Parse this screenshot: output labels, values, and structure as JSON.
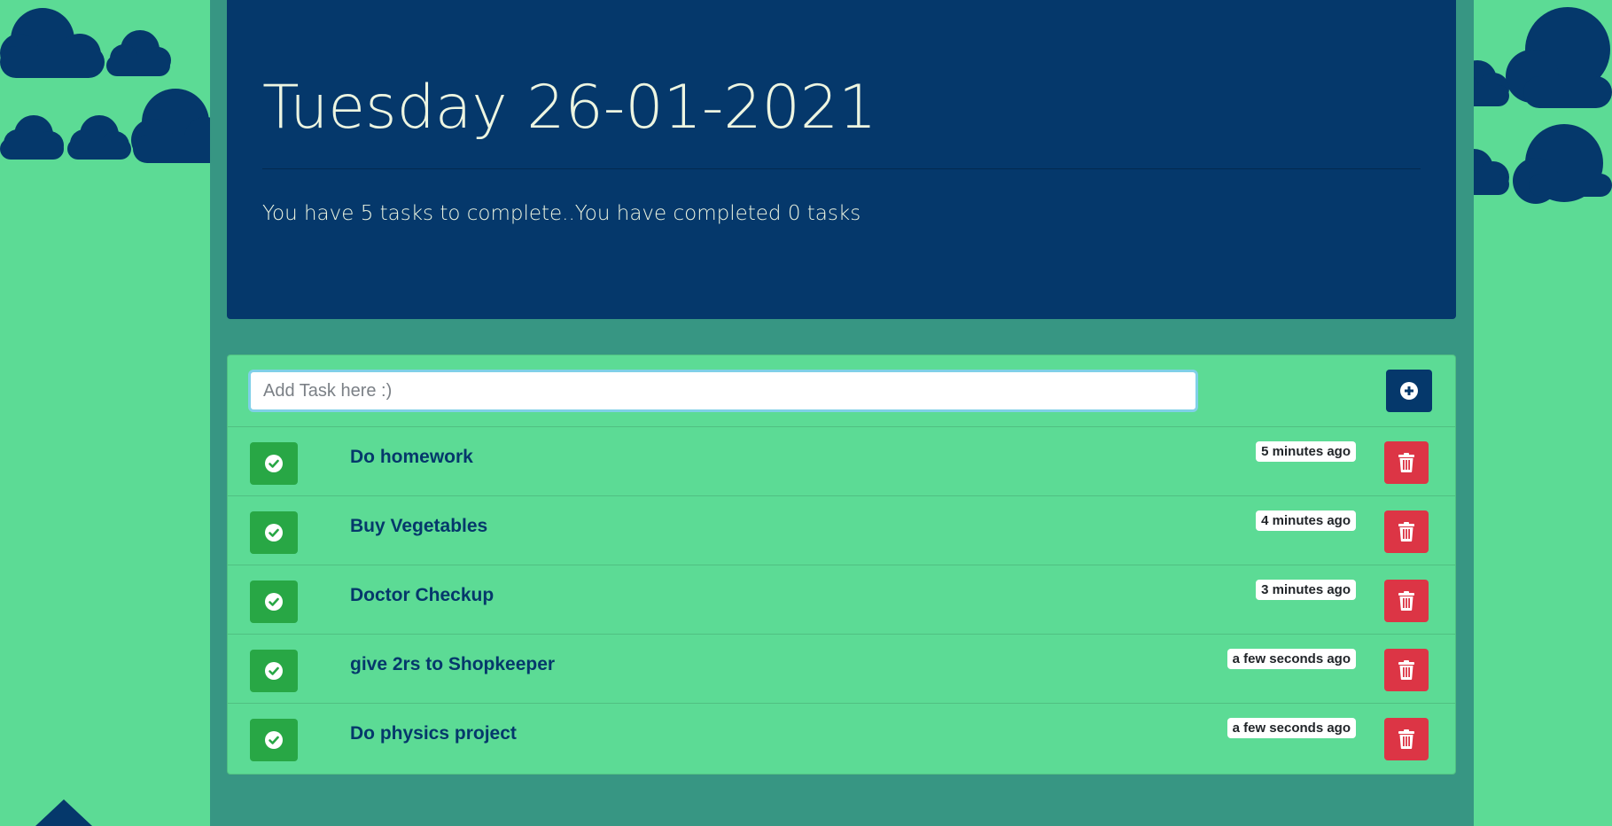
{
  "header": {
    "date_title": "Tuesday 26-01-2021",
    "summary": "You have 5 tasks to complete..You have completed 0 tasks"
  },
  "add_task": {
    "placeholder": "Add Task here :)",
    "value": "",
    "add_icon": "plus-circle-icon"
  },
  "tasks": [
    {
      "name": "Do homework",
      "time": "5 minutes ago"
    },
    {
      "name": "Buy Vegetables",
      "time": "4 minutes ago"
    },
    {
      "name": "Doctor Checkup",
      "time": "3 minutes ago"
    },
    {
      "name": "give 2rs to Shopkeeper",
      "time": "a few seconds ago"
    },
    {
      "name": "Do physics project",
      "time": "a few seconds ago"
    }
  ],
  "icons": {
    "complete": "check-circle-icon",
    "delete": "trash-icon"
  },
  "colors": {
    "background": "#5cdb95",
    "panel": "#379683",
    "header": "#05386b",
    "complete_button": "#28a745",
    "delete_button": "#dc3545"
  }
}
